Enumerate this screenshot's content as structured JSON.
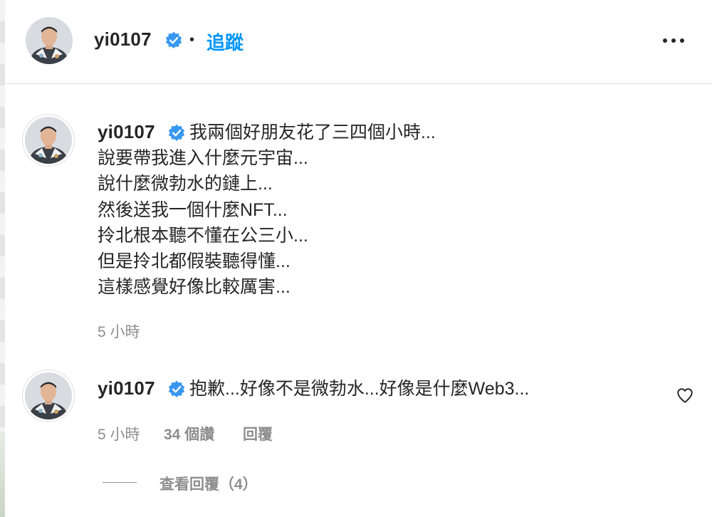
{
  "header": {
    "username": "yi0107",
    "separator": "•",
    "follow_label": "追蹤"
  },
  "post": {
    "username": "yi0107",
    "caption_lines": [
      "我兩個好朋友花了三四個小時...",
      "說要帶我進入什麼元宇宙...",
      "說什麼微勃水的鏈上...",
      "然後送我一個什麼NFT...",
      "拎北根本聽不懂在公三小...",
      "但是拎北都假裝聽得懂...",
      "這樣感覺好像比較厲害..."
    ],
    "time": "5 小時"
  },
  "comment": {
    "username": "yi0107",
    "text": "抱歉...好像不是微勃水...好像是什麼Web3...",
    "time": "5 小時",
    "likes": "34 個讚",
    "reply_label": "回覆",
    "view_replies": "查看回覆（4）"
  },
  "colors": {
    "text": "#262626",
    "secondary": "#8e8e8e",
    "link": "#0095f6",
    "verified": "#3897f0",
    "divider": "#dbdbdb"
  },
  "icons": [
    "verified-badge-icon",
    "more-options-icon",
    "heart-icon"
  ]
}
